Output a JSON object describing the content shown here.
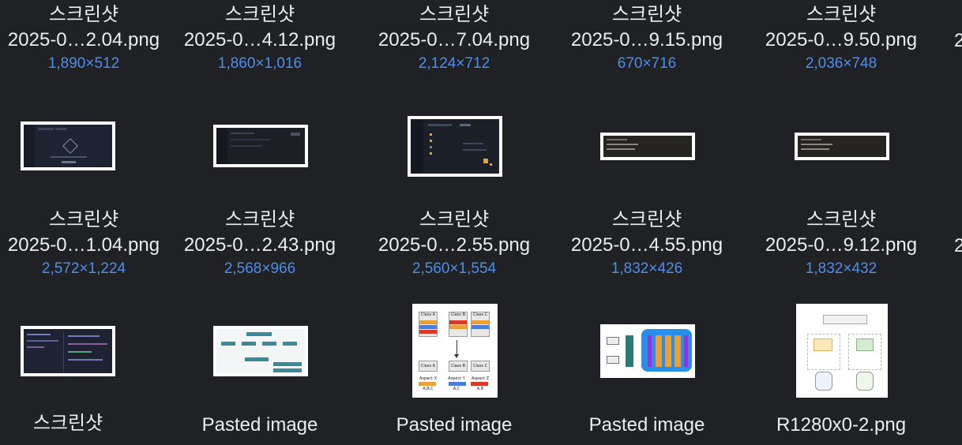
{
  "items": [
    {
      "line1": "스크린샷",
      "line2": "2025-0…2.04.png",
      "dims": "1,890×512"
    },
    {
      "line1": "스크린샷",
      "line2": "2025-0…4.12.png",
      "dims": "1,860×1,016"
    },
    {
      "line1": "스크린샷",
      "line2": "2025-0…7.04.png",
      "dims": "2,124×712"
    },
    {
      "line1": "스크린샷",
      "line2": "2025-0…9.15.png",
      "dims": "670×716"
    },
    {
      "line1": "스크린샷",
      "line2": "2025-0…9.50.png",
      "dims": "2,036×748"
    },
    {
      "line1": "스크린샷",
      "line2": "2025-0…1.04.png",
      "dims": "2,572×1,224"
    },
    {
      "line1": "스크린샷",
      "line2": "2025-0…2.43.png",
      "dims": "2,568×966"
    },
    {
      "line1": "스크린샷",
      "line2": "2025-0…2.55.png",
      "dims": "2,560×1,554"
    },
    {
      "line1": "스크린샷",
      "line2": "2025-0…4.55.png",
      "dims": "1,832×426"
    },
    {
      "line1": "스크린샷",
      "line2": "2025-0…9.12.png",
      "dims": "1,832×432"
    },
    {
      "line1": "스크린샷",
      "line2": "",
      "dims": ""
    },
    {
      "line1": "Pasted image",
      "line2": "",
      "dims": ""
    },
    {
      "line1": "Pasted image",
      "line2": "",
      "dims": ""
    },
    {
      "line1": "Pasted image",
      "line2": "",
      "dims": ""
    },
    {
      "line1": "R1280x0-2.png",
      "line2": "",
      "dims": ""
    }
  ],
  "thumb_text": {
    "class_a": "Class A",
    "class_b": "Class B",
    "class_c": "Class C",
    "aspect_x": "Aspect X",
    "aspect_y": "Aspect Y",
    "aspect_z": "Aspect Z",
    "abc": "A,B,C",
    "ac": "A,C",
    "ab": "A,B"
  },
  "colors": {
    "background": "#1f2124",
    "name_text": "#ececee",
    "dims_text": "#4e8ee8"
  }
}
